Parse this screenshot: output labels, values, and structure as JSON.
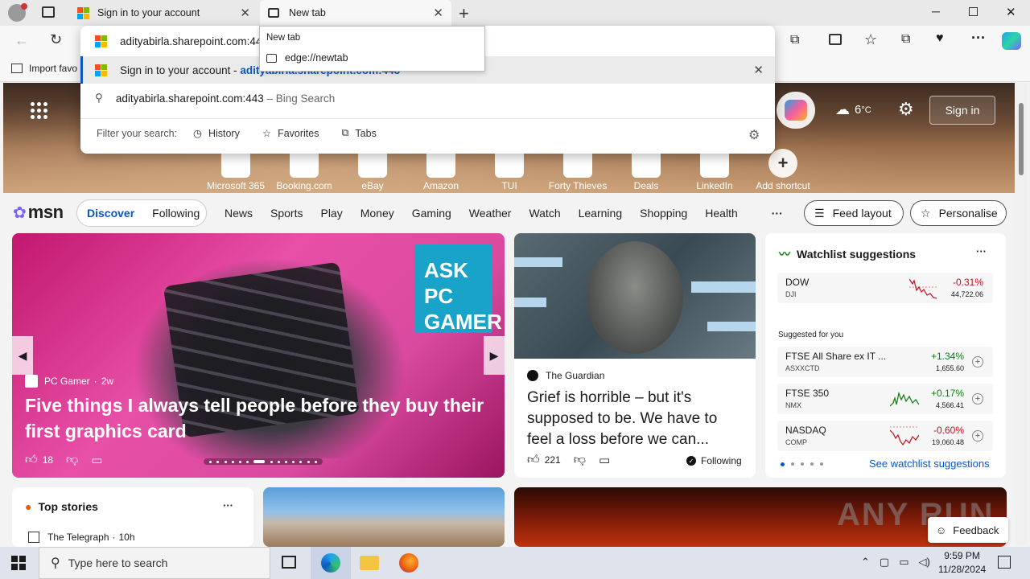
{
  "tabs": [
    {
      "title": "Sign in to your account"
    },
    {
      "title": "New tab"
    }
  ],
  "tooltip": {
    "title": "New tab",
    "url": "edge://newtab"
  },
  "address": {
    "value": "adityabirla.sharepoint.com:443"
  },
  "omnibox": {
    "suggestion1": {
      "title": "Sign in to your account",
      "sep": " - ",
      "url": "adityabirla.sharepoint.com:443"
    },
    "suggestion2": {
      "query": "adityabirla.sharepoint.com:443",
      "suffix": " – Bing Search"
    },
    "filter_label": "Filter your search:",
    "filters": [
      "History",
      "Favorites",
      "Tabs"
    ]
  },
  "favbar": {
    "import": "Import favo"
  },
  "hero": {
    "weather_temp": "6",
    "weather_unit": "°C",
    "signin": "Sign in"
  },
  "shortcuts": [
    {
      "label": "Microsoft 365",
      "icon": "m365-icon"
    },
    {
      "label": "Booking.com",
      "icon": "booking-icon"
    },
    {
      "label": "eBay",
      "icon": "ebay-icon"
    },
    {
      "label": "Amazon",
      "icon": "amazon-icon"
    },
    {
      "label": "TUI",
      "icon": "tui-icon"
    },
    {
      "label": "Forty Thieves",
      "icon": "cards-icon"
    },
    {
      "label": "Deals",
      "icon": "deals-icon"
    },
    {
      "label": "LinkedIn",
      "icon": "linkedin-icon"
    },
    {
      "label": "Add shortcut",
      "icon": "plus-icon"
    }
  ],
  "msn": {
    "logo": "msn",
    "pill": [
      "Discover",
      "Following"
    ],
    "nav": [
      "News",
      "Sports",
      "Play",
      "Money",
      "Gaming",
      "Weather",
      "Watch",
      "Learning",
      "Shopping",
      "Health"
    ],
    "more": "···",
    "feed_layout": "Feed layout",
    "personalise": "Personalise"
  },
  "main_story": {
    "source": "PC Gamer",
    "age": "2w",
    "headline": "Five things I always tell people before they buy their first graphics card",
    "likes": "18",
    "badge_line1": "ASK PC",
    "badge_line2": "GAMER"
  },
  "guardian": {
    "source": "The Guardian",
    "headline": "Grief is horrible – but it's supposed to be. We have to feel a loss before we can...",
    "likes": "221",
    "following": "Following"
  },
  "watchlist": {
    "title": "Watchlist suggestions",
    "more": "···",
    "dow": {
      "name": "DOW",
      "sub": "DJI",
      "change": "-0.31%",
      "value": "44,722.06",
      "color": "#c50f1f"
    },
    "suggested_label": "Suggested for you",
    "items": [
      {
        "name": "FTSE All Share ex IT ...",
        "sub": "ASXXCTD",
        "change": "+1.34%",
        "value": "1,655.60",
        "color": "#0f7b0f"
      },
      {
        "name": "FTSE 350",
        "sub": "NMX",
        "change": "+0.17%",
        "value": "4,566.41",
        "color": "#0f7b0f"
      },
      {
        "name": "NASDAQ",
        "sub": "COMP",
        "change": "-0.60%",
        "value": "19,060.48",
        "color": "#c50f1f"
      }
    ],
    "see_more": "See watchlist suggestions"
  },
  "top_stories": {
    "title": "Top stories",
    "more": "···",
    "source": "The Telegraph",
    "age": "10h"
  },
  "feedback": "Feedback",
  "watermark": "ANY RUN",
  "taskbar": {
    "search_placeholder": "Type here to search",
    "time": "9:59 PM",
    "date": "11/28/2024"
  }
}
